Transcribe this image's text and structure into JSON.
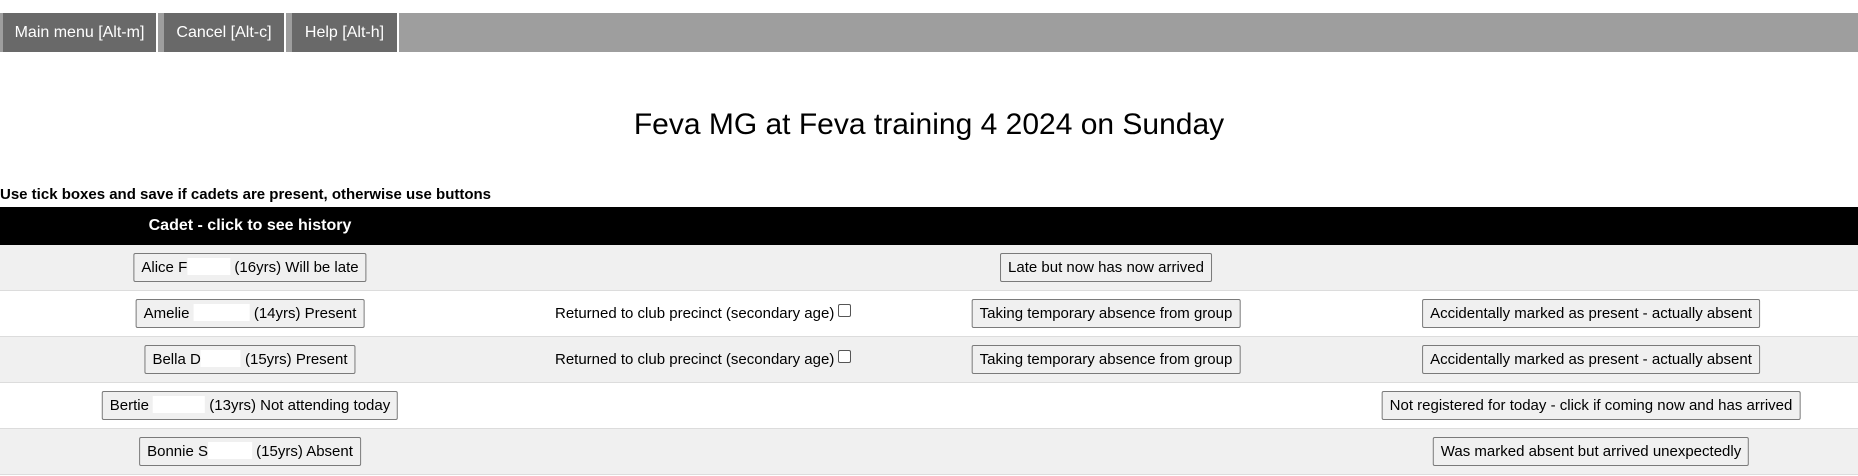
{
  "menu": {
    "main_menu": "Main menu [Alt-m]",
    "cancel": "Cancel [Alt-c]",
    "help": "Help [Alt-h]"
  },
  "page": {
    "title": "Feva MG at Feva training 4 2024 on Sunday",
    "instructions": "Use tick boxes and save if cadets are present, otherwise use buttons"
  },
  "table": {
    "header": "Cadet - click to see history",
    "secondary_label": "Returned to club precinct (secondary age)",
    "rows": [
      {
        "first_name": "Alice",
        "surname_initial": "F",
        "status": "(16yrs) Will be late",
        "middle_action": "Late but now has now arrived",
        "right_action": ""
      },
      {
        "first_name": "Amelie",
        "surname_initial": "",
        "status": "(14yrs) Present",
        "middle_action": "Taking temporary absence from group",
        "right_action": "Accidentally marked as present - actually absent",
        "secondary_checked": false
      },
      {
        "first_name": "Bella",
        "surname_initial": "D",
        "status": "(15yrs) Present",
        "middle_action": "Taking temporary absence from group",
        "right_action": "Accidentally marked as present - actually absent",
        "secondary_checked": false
      },
      {
        "first_name": "Bertie",
        "surname_initial": "",
        "status": "(13yrs) Not attending today",
        "middle_action": "",
        "right_action": "Not registered for today - click if coming now and has arrived"
      },
      {
        "first_name": "Bonnie",
        "surname_initial": "S",
        "status": "(15yrs) Absent",
        "middle_action": "",
        "right_action": "Was marked absent but arrived unexpectedly"
      }
    ]
  }
}
